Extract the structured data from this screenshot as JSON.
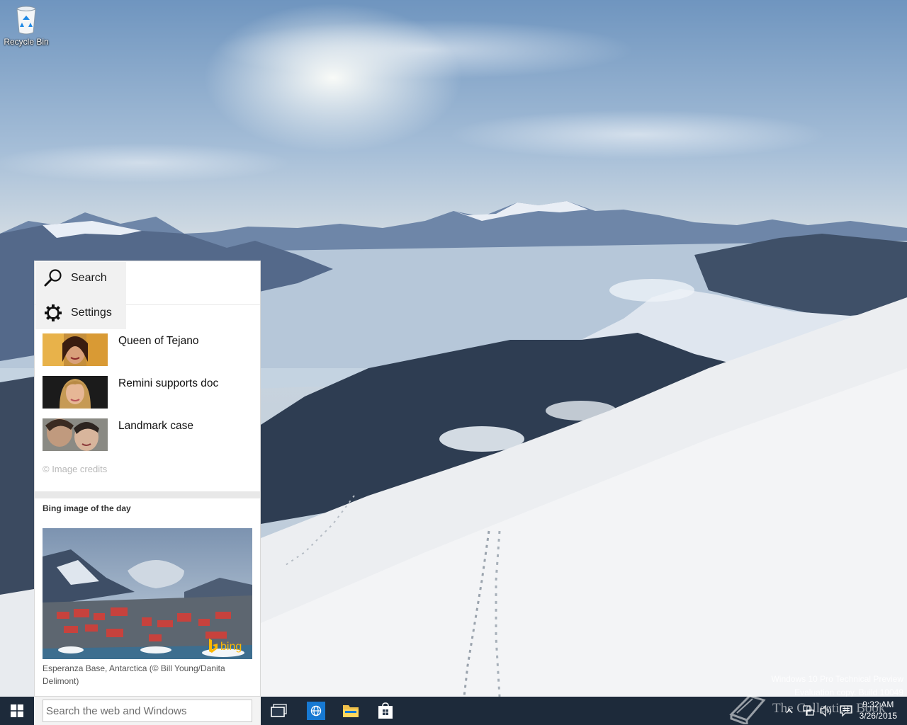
{
  "desktop": {
    "recycle_bin_label": "Recycle Bin",
    "watermark_line1": "Windows 10 Pro Technical Preview",
    "watermark_line2": "Evaluation copy. Build 10049"
  },
  "flyout": {
    "menu": [
      {
        "label": "Search",
        "icon": "search-icon"
      },
      {
        "label": "Settings",
        "icon": "gear-icon"
      }
    ],
    "news": [
      {
        "title": "Queen of Tejano"
      },
      {
        "title": "Remini supports doc"
      },
      {
        "title": "Landmark case"
      }
    ],
    "image_credits": "© Image credits",
    "bing_section_title": "Bing image of the day",
    "bing_logo_text": "bing",
    "bing_caption": "Esperanza Base, Antarctica (© Bill Young/Danita Delimont)"
  },
  "taskbar": {
    "search_placeholder": "Search the web and Windows",
    "pinned": [
      "task-view-icon",
      "internet-explorer-icon",
      "file-explorer-icon",
      "store-icon"
    ],
    "tray_icons": [
      "show-hidden-icons-icon",
      "network-icon",
      "volume-icon",
      "action-center-icon"
    ],
    "time": "9:32 AM",
    "date": "3/26/2015",
    "overlay_text": "The Collection Book"
  },
  "colors": {
    "taskbar": "#1d2a3a",
    "accent_blue": "#1779d2",
    "bing_yellow": "#ffb900"
  }
}
